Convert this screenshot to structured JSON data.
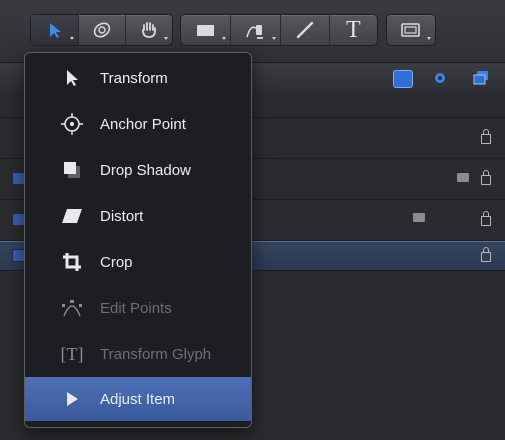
{
  "toolbar": {
    "groups": [
      {
        "tools": [
          "select-transform-tool",
          "orbit-tool",
          "pan-tool"
        ]
      },
      {
        "tools": [
          "rectangle-shape-tool",
          "bezier-tool",
          "paint-stroke-tool",
          "text-tool"
        ]
      },
      {
        "tools": [
          "mask-tool"
        ]
      }
    ],
    "text_tool_glyph": "T"
  },
  "menu": {
    "items": [
      {
        "label": "Transform",
        "icon": "arrow-pointer-icon",
        "enabled": true,
        "highlighted": false
      },
      {
        "label": "Anchor Point",
        "icon": "anchor-point-icon",
        "enabled": true,
        "highlighted": false
      },
      {
        "label": "Drop Shadow",
        "icon": "drop-shadow-icon",
        "enabled": true,
        "highlighted": false
      },
      {
        "label": "Distort",
        "icon": "distort-icon",
        "enabled": true,
        "highlighted": false
      },
      {
        "label": "Crop",
        "icon": "crop-icon",
        "enabled": true,
        "highlighted": false
      },
      {
        "label": "Edit Points",
        "icon": "edit-points-icon",
        "enabled": false,
        "highlighted": false
      },
      {
        "label": "Transform Glyph",
        "icon": "transform-glyph-icon",
        "enabled": false,
        "highlighted": false
      },
      {
        "label": "Adjust Item",
        "icon": "adjust-item-icon",
        "enabled": true,
        "highlighted": true
      }
    ],
    "glyph_icon_text": "[T]"
  },
  "colors": {
    "menu_background": "#1d1e21",
    "highlight": "#4466aa",
    "checkbox_blue": "#3b5fae",
    "panel_icon_blue": "#2f6fd8"
  }
}
